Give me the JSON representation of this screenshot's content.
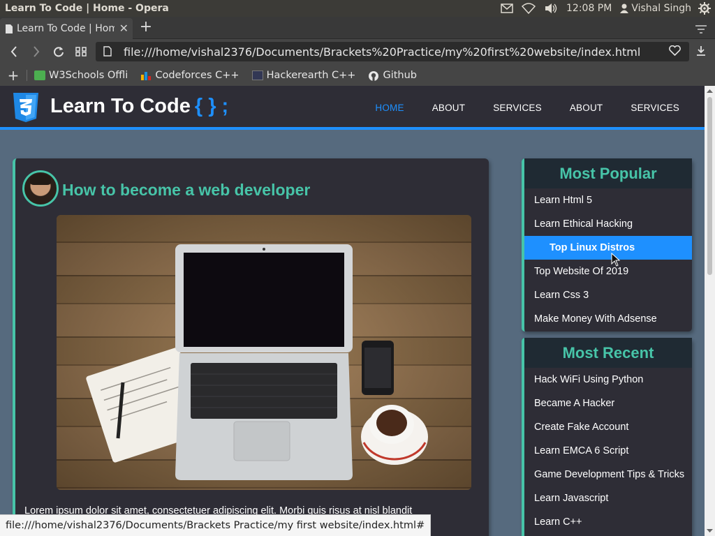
{
  "os": {
    "window_title": "Learn To Code | Home - Opera",
    "clock": "12:08 PM",
    "user": "Vishal Singh"
  },
  "browser": {
    "tab_label": "Learn To Code | Home",
    "url": "file:///home/vishal2376/Documents/Brackets%20Practice/my%20first%20website/index.html",
    "bookmarks": [
      {
        "label": "W3Schools Offli",
        "icon": "w3schools-icon",
        "color": "#4caf50"
      },
      {
        "label": "Codeforces C++",
        "icon": "codeforces-icon",
        "color": "#f5b400"
      },
      {
        "label": "Hackerearth C++",
        "icon": "hackerearth-icon",
        "color": "#323754"
      },
      {
        "label": "Github",
        "icon": "github-icon",
        "color": "#e6e6e6"
      }
    ],
    "status_url": "file:///home/vishal2376/Documents/Brackets Practice/my first website/index.html#"
  },
  "site": {
    "brand": "Learn To Code",
    "brand_suffix": "{ } ;",
    "nav": [
      {
        "label": "HOME",
        "active": true
      },
      {
        "label": "ABOUT",
        "active": false
      },
      {
        "label": "SERVICES",
        "active": false
      },
      {
        "label": "ABOUT",
        "active": false
      },
      {
        "label": "SERVICES",
        "active": false
      }
    ],
    "accent_color": "#1e90ff",
    "teal_color": "#47c4a8"
  },
  "article": {
    "title": "How to become a web developer",
    "lorem": "Lorem ipsum dolor sit amet, consectetuer adipiscing elit. Morbi quis risus at nisl blandit"
  },
  "sidebar": {
    "popular": {
      "heading": "Most Popular",
      "items": [
        "Learn Html 5",
        "Learn Ethical Hacking",
        "Top Linux Distros",
        "Top Website Of 2019",
        "Learn Css 3",
        "Make Money With Adsense"
      ]
    },
    "recent": {
      "heading": "Most Recent",
      "items": [
        "Hack WiFi Using Python",
        "Became A Hacker",
        "Create Fake Account",
        "Learn EMCA 6 Script",
        "Game Development Tips & Tricks",
        "Learn Javascript",
        "Learn C++"
      ]
    }
  }
}
